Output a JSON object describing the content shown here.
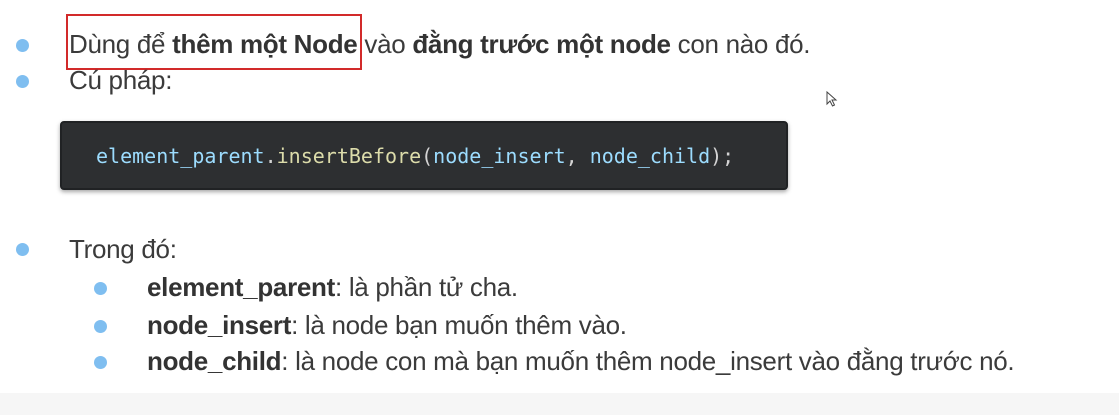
{
  "intro": {
    "prefix": "Dùng để ",
    "bold1": "thêm một Node",
    "mid": " vào ",
    "bold2": "đằng trước một node",
    "suffix": " con nào đó."
  },
  "syntax_label": "Cú pháp:",
  "code": {
    "object": "element_parent",
    "dot": ".",
    "method": "insertBefore",
    "open_paren": "(",
    "arg1": "node_insert",
    "comma": ", ",
    "arg2": "node_child",
    "close": ");"
  },
  "where_label": "Trong đó:",
  "params": [
    {
      "name": "element_parent",
      "desc": ": là phần tử cha."
    },
    {
      "name": "node_insert",
      "desc": ": là node bạn muốn thêm vào."
    },
    {
      "name": "node_child",
      "desc": ": là node con mà bạn muốn thêm node_insert vào đằng trước nó."
    }
  ],
  "colors": {
    "bullet": "#7fbef0",
    "highlight_border": "#d22a2a",
    "code_background": "#2d2f31"
  },
  "icons": {
    "cursor": "mouse-pointer-icon",
    "bullet": "bullet-dot-icon"
  }
}
